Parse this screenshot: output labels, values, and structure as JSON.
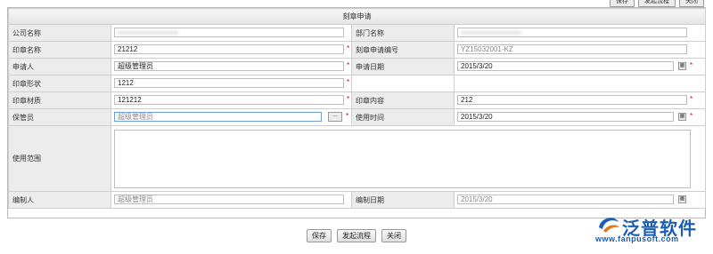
{
  "toolbar_top": {
    "save": "保存",
    "start_flow": "发起流程",
    "close": "关闭"
  },
  "form": {
    "title": "刻章申请",
    "company_name": {
      "label": "公司名称",
      "value": "xxxxxxxxxxxxxxxxx"
    },
    "department_name": {
      "label": "部门名称",
      "value": "xxxxxxxxxxxxxxxxx"
    },
    "seal_name": {
      "label": "印章名称",
      "value": "21212"
    },
    "application_no": {
      "label": "刻章申请编号",
      "value": "YZ15032001-KZ"
    },
    "applicant": {
      "label": "申请人",
      "value": "超级管理员"
    },
    "apply_date": {
      "label": "申请日期",
      "value": "2015/3/20"
    },
    "seal_shape": {
      "label": "印章形状",
      "value": "1212"
    },
    "seal_material": {
      "label": "印章材质",
      "value": "121212"
    },
    "seal_content": {
      "label": "印章内容",
      "value": "212"
    },
    "keeper": {
      "label": "保管员",
      "value": "超级管理员"
    },
    "use_time": {
      "label": "使用时间",
      "value": "2015/3/20"
    },
    "use_scope": {
      "label": "使用范围",
      "value": ""
    },
    "preparer": {
      "label": "编制人",
      "value": "超级管理员"
    },
    "prepare_date": {
      "label": "编制日期",
      "value": "2015/3/20"
    }
  },
  "buttons": {
    "save": "保存",
    "start_flow": "发起流程",
    "close": "关闭"
  },
  "logo": {
    "brand": "泛普软件",
    "url": "www.fanpusoft.com"
  },
  "symbols": {
    "required": "*",
    "dots": "...",
    "calendar": "▦"
  },
  "colors": {
    "brand": "#1a5fb4",
    "required": "#d00000"
  }
}
